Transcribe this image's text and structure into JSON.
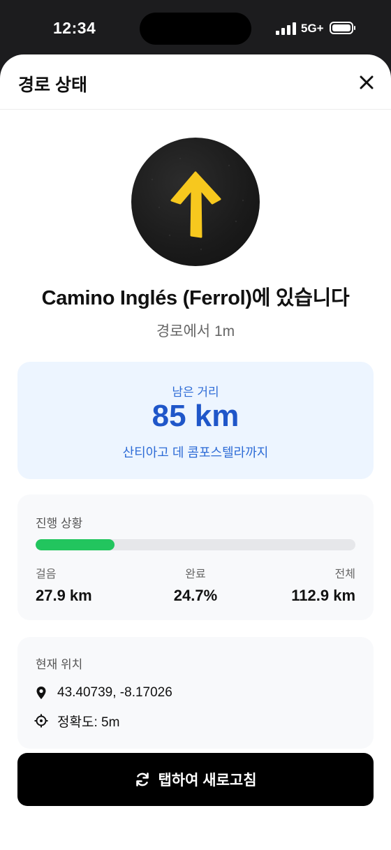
{
  "status_bar": {
    "time": "12:34",
    "network": "5G+"
  },
  "header": {
    "title": "경로 상태"
  },
  "route": {
    "title": "Camino Inglés (Ferrol)에 있습니다",
    "subtitle": "경로에서 1m"
  },
  "distance": {
    "label": "남은 거리",
    "value": "85 km",
    "note": "산티아고 데 콤포스텔라까지"
  },
  "progress": {
    "label": "진행 상황",
    "fraction": 0.247,
    "walked_label": "걸음",
    "walked_value": "27.9 km",
    "complete_label": "완료",
    "complete_value": "24.7%",
    "total_label": "전체",
    "total_value": "112.9 km",
    "bar_color": "#22c55e"
  },
  "location": {
    "label": "현재 위치",
    "coords": "43.40739, -8.17026",
    "accuracy": "정확도: 5m"
  },
  "refresh": {
    "label": "탭하여 새로고침"
  },
  "colors": {
    "accent_blue": "#1f56c9",
    "arrow_yellow": "#f7c81e"
  },
  "icons": [
    "close-icon",
    "arrow-up-icon",
    "map-pin-icon",
    "crosshair-icon",
    "refresh-icon"
  ]
}
